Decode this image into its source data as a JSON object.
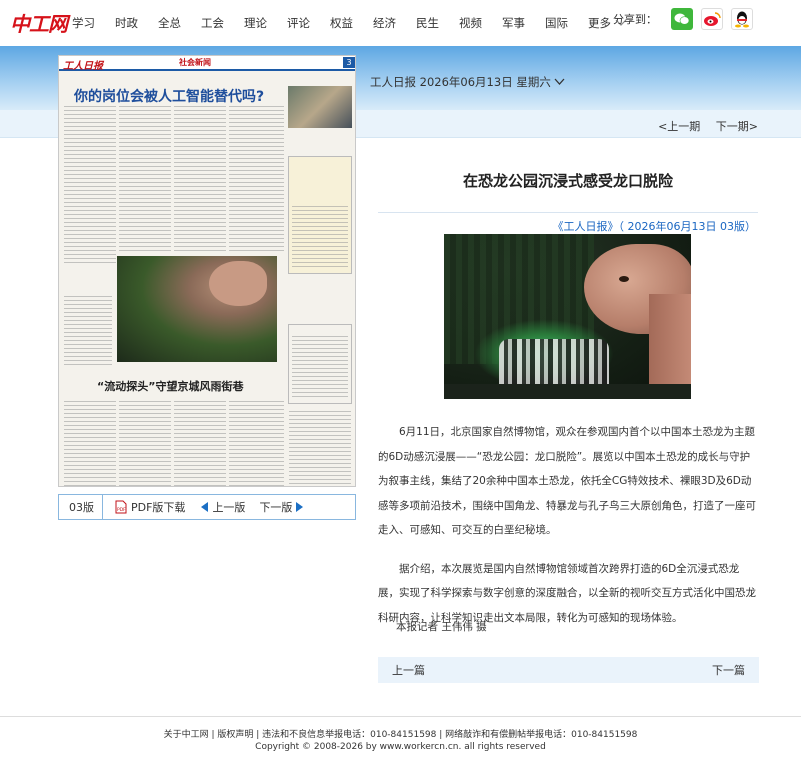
{
  "nav": {
    "logo": "中工网",
    "items": [
      "学习",
      "时政",
      "全总",
      "工会",
      "理论",
      "评论",
      "权益",
      "经济",
      "民生",
      "视频",
      "军事",
      "国际"
    ],
    "more": "更多"
  },
  "share": {
    "label": "分享到：",
    "icons": [
      "wechat-icon",
      "weibo-icon",
      "qq-icon"
    ]
  },
  "dateline": "工人日报 2026年06月13日 星期六",
  "pager_top": {
    "prev": "<上一期",
    "next": "下一期>"
  },
  "paper": {
    "name": "工人日报",
    "section": "社会新闻",
    "page_number": "3",
    "lead_title": "你的岗位会被人工智能替代吗?",
    "headline2": "“流动探头”守望京城风雨街巷"
  },
  "page_nav": {
    "page": "03版",
    "pdf": "PDF版下载",
    "prev": "上一版",
    "next": "下一版"
  },
  "article": {
    "title": "在恐龙公园沉浸式感受龙口脱险",
    "source": "《工人日报》（ 2026年06月13日 03版）",
    "paragraphs": [
      "6月11日，北京国家自然博物馆，观众在参观国内首个以中国本土恐龙为主题的6D动感沉浸展——“恐龙公园：龙口脱险”。展览以中国本土恐龙的成长与守护为叙事主线，集结了20余种中国本土恐龙，依托全CG特效技术、裸眼3D及6D动感等多项前沿技术，围绕中国角龙、特暴龙与孔子鸟三大原创角色，打造了一座可走入、可感知、可交互的白垩纪秘境。",
      "据介绍，本次展览是国内自然博物馆领域首次跨界打造的6D全沉浸式恐龙展，实现了科学探索与数字创意的深度融合，以全新的视听交互方式活化中国恐龙科研内容，让科学知识走出文本局限，转化为可感知的现场体验。"
    ],
    "reporter": "本报记者 王伟伟 摄",
    "prev": "上一篇",
    "next": "下一篇"
  },
  "footer": {
    "line1": "关于中工网 | 版权声明 | 违法和不良信息举报电话：010-84151598 | 网络敲诈和有偿删帖举报电话：010-84151598",
    "line2": "Copyright © 2008-2026 by www.workercn.cn. all rights reserved"
  },
  "colors": {
    "brand_red": "#d6121a",
    "link_blue": "#1a66c2",
    "band_blue": "#5da7e3"
  }
}
